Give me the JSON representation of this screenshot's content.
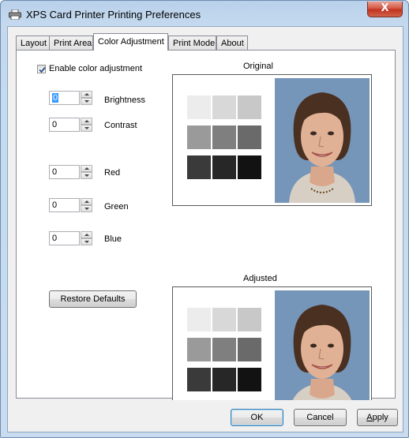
{
  "window": {
    "title": "XPS Card Printer Printing Preferences",
    "close_symbol": "X"
  },
  "tabs": [
    {
      "label": "Layout"
    },
    {
      "label": "Print Area"
    },
    {
      "label": "Color Adjustment",
      "active": true
    },
    {
      "label": "Print Mode"
    },
    {
      "label": "About"
    }
  ],
  "color_adjustment": {
    "enable_label": "Enable color adjustment",
    "enable_checked": true,
    "brightness": {
      "value": "0",
      "label": "Brightness"
    },
    "contrast": {
      "value": "0",
      "label": "Contrast"
    },
    "red": {
      "value": "0",
      "label": "Red"
    },
    "green": {
      "value": "0",
      "label": "Green"
    },
    "blue": {
      "value": "0",
      "label": "Blue"
    },
    "restore_label": "Restore Defaults"
  },
  "previews": {
    "original_label": "Original",
    "adjusted_label": "Adjusted",
    "swatch_colors": [
      "#ececec",
      "#d8d8d8",
      "#c8c8c8",
      "#9a9a9a",
      "#7f7f7f",
      "#6a6a6a",
      "#3a3a3a",
      "#272727",
      "#121212"
    ],
    "photo_bg": "#7595b9"
  },
  "buttons": {
    "ok": "OK",
    "cancel": "Cancel",
    "apply": "Apply",
    "apply_accel": "A",
    "apply_rest": "pply"
  }
}
